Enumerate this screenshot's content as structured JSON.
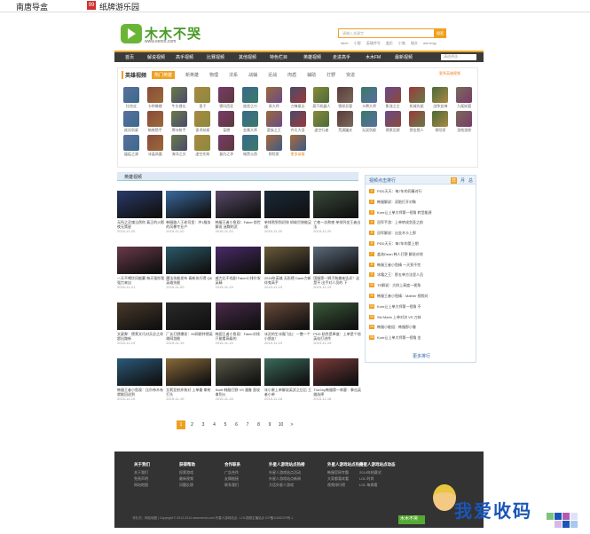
{
  "window": {
    "tab1": "南唐导盒",
    "tab2": "纸牌游乐园"
  },
  "site": {
    "name": "木木不哭",
    "url": "www.eenot.com"
  },
  "search": {
    "placeholder": "请输入关键字",
    "button": "搜索",
    "hot": [
      "faker",
      "小智",
      "英雄传号",
      "盖伦",
      "小鬼",
      "瑞文",
      "adminqy"
    ]
  },
  "nav": {
    "items": [
      "首页",
      "解说视频",
      "高手视频",
      "比赛视频",
      "其他视频",
      "特色栏目",
      "英雄视频",
      "走进高手",
      "木木FM",
      "最新视频"
    ],
    "select": "请选择选..."
  },
  "panel": {
    "title": "英雄视频",
    "tabs": [
      "热门英雄",
      "新英雄",
      "物理",
      "法系",
      "战辅",
      "近战",
      "肉盾",
      "辅助",
      "打野",
      "突进"
    ],
    "more": "更多英雄视频",
    "heroes": [
      "拉克丝",
      "卡特琳娜",
      "牛头酋长",
      "皇子",
      "德玛西亚",
      "放逐之刃",
      "易大师",
      "刀锋意志",
      "蒸汽机器人",
      "德邦总管",
      "卡牌大师",
      "影流之主",
      "机械先驱",
      "战争女神",
      "九尾妖狐",
      "疾风剑豪",
      "暗夜猎手",
      "寒冰射手",
      "诡术妖姬",
      "盲僧",
      "金属大师",
      "蛮族之王",
      "齐天大圣",
      "虚空行者",
      "荒漠屠夫",
      "无双剑姬",
      "德莱厄斯",
      "赏金猎人",
      "探险家",
      "圣枪游侠",
      "瘟疫之源",
      "冰晶凤凰",
      "海洋之灾",
      "虚空先知",
      "复仇之矛",
      "暗黑元首"
    ],
    "hero_last": "探险家",
    "hero_highlight": "更多英雄"
  },
  "videos": {
    "title": "英雄视频",
    "items": [
      {
        "t": "无所之灵魂当然你 真正的火影夜无策星",
        "d": "2015-11-20"
      },
      {
        "t": "韩服路人王老司里：冲1服务的风暴专业户",
        "d": "2015-11-20"
      },
      {
        "t": "韩服王者小鱼观：Faker 前世解说 迷糊的武",
        "d": "2015-11-20"
      },
      {
        "t": "单排熬到到初排 蚂蚁尽统能足成",
        "d": "2015-11-20"
      },
      {
        "t": "亡夜一次熬夜 单排列坐王者出法",
        "d": "2015-11-20"
      },
      {
        "t": "一天不喝饮风能赢 每天强你我强力来自",
        "d": "2015-11-21"
      },
      {
        "t": "魔法技能发布 青新技巧得 Q6英雄技能",
        "d": "2015-11-20"
      },
      {
        "t": "威力后不戏剧 Faker小排尔发英精",
        "d": "2015-11-19"
      },
      {
        "t": "2015年英雄 无形德 Dade力新 伴鬼高手",
        "d": "2015-11-19"
      },
      {
        "t": "国服第一狮子狗美味告诉！这是不 出手对人员的 下",
        "d": "2015-11-19"
      },
      {
        "t": "文豪弊：德莱文巧对兵总之命 超出路新",
        "d": "2015-11-19"
      },
      {
        "t": "厂长打野爆发：99网斯特德英雄网游能",
        "d": "2015-11-19"
      },
      {
        "t": "韩国王者小鱼观：Faker对线 只能看高级的",
        "d": "2015-11-19"
      },
      {
        "t": "冰灵的生冰霜飞出：一整一个小朋友！",
        "d": "2015-11-19"
      },
      {
        "t": "PDD 粘性是奉度：上单是个他英站打进作",
        "d": "2015-11-19"
      },
      {
        "t": "韩服王者小鱼观：比尔帝木有 就能回送到",
        "d": "2015-11-19"
      },
      {
        "t": "艾莉亚射炸装对 上单最 拳射打头",
        "d": "2015-11-19"
      },
      {
        "t": "Swift 韩服打野 VS 潘鲁 直攻拿到火",
        "d": "2015-11-18"
      },
      {
        "t": "冰小果上单解说英武之后后 王者小单",
        "d": "2015-11-18"
      },
      {
        "t": "TheShy韩服第一刺客：拳击英雄选择",
        "d": "2015-11-18"
      }
    ]
  },
  "ranking": {
    "title": "视频点击排行",
    "tabs": [
      "日",
      "月",
      "总"
    ],
    "items": [
      "PDD天天：每7年的同事对行",
      "韩服解说：双胎打开对象",
      "Kore让上单大师第一视角 转型能源",
      "冠军手游：上单转成剑圣之前",
      "冠军解说：出金木卡上那",
      "PDD天天：每7年的第上期",
      "盖洛Dean 韩人打野 解说对线",
      "韩服王者小鱼精 一天到不完",
      "冰霜之王：那五单方法里人员",
      "TE解说：大树上高度一视角",
      "韩服王者小鱼精：Mather 视频对",
      "Kore让上单大师第一视角 不",
      "Skt Marin 上单对决 VS 刀妹",
      "韩服小能组：韩服那小鲁",
      "Kore让上单大师第一视角 金"
    ],
    "more": "更多排行"
  },
  "pager": {
    "pages": [
      "1",
      "2",
      "3",
      "4",
      "5",
      "6",
      "7",
      "8",
      "9",
      "10",
      ">"
    ]
  },
  "footer": {
    "cols": [
      {
        "h": "关于我们",
        "items": [
          "关于我们",
          "免责声明",
          "网站地图"
        ]
      },
      {
        "h": "获得帮助",
        "items": [
          "投票游戏",
          "最新视频",
          "问题反馈"
        ]
      },
      {
        "h": "合作联系",
        "items": [
          "广告合作",
          "友情链接",
          "联系我们"
        ]
      },
      {
        "h": "外星人游戏站点热榜",
        "items": [
          "外星人游戏站点活动",
          "外星人游戏站点新闻",
          "大话外星人游戏"
        ]
      },
      {
        "h": "外星人游戏站点热榜",
        "items": [
          "韩服官网专题",
          "大家都喜欢看",
          "视频排行榜"
        ]
      },
      {
        "h": "外星人游戏站点动态",
        "items": [
          "2014年热赛式",
          "LOL 时尚",
          "LOL 每周看"
        ]
      }
    ],
    "copyright": "非礼勿，网站地图 | Copyright © 2012-2014 www.eenot.com 外星人游戏站点 - LOL视频主播站点 ICP备11002479号-1",
    "logo": "木木不哭"
  },
  "watermark": "我爱收码"
}
